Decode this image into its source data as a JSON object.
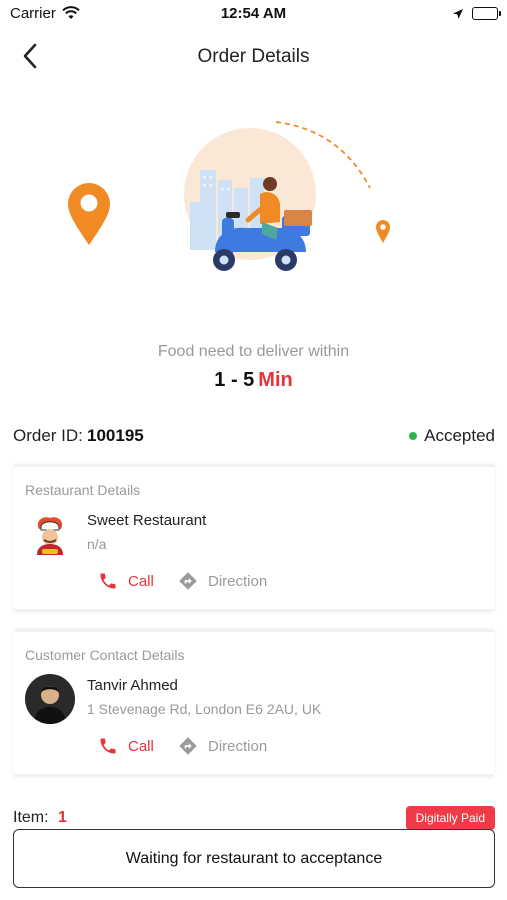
{
  "status_bar": {
    "carrier": "Carrier",
    "time": "12:54 AM"
  },
  "nav": {
    "title": "Order Details",
    "back_icon": "chevron-left-icon"
  },
  "delivery": {
    "label": "Food need to deliver within",
    "time_range": "1 - 5",
    "time_unit": "Min"
  },
  "order": {
    "id_label": "Order ID:",
    "id_value": "100195",
    "status": "Accepted",
    "status_color": "#2fb34b"
  },
  "restaurant": {
    "title": "Restaurant Details",
    "name": "Sweet Restaurant",
    "sub": "n/a",
    "call_label": "Call",
    "direction_label": "Direction"
  },
  "customer": {
    "title": "Customer Contact Details",
    "name": "Tanvir Ahmed",
    "address": "1 Stevenage Rd, London E6 2AU, UK",
    "call_label": "Call",
    "direction_label": "Direction"
  },
  "items": {
    "label": "Item:",
    "count": "1",
    "payment_badge": "Digitally Paid"
  },
  "footer": {
    "button_label": "Waiting for restaurant to acceptance"
  },
  "colors": {
    "accent": "#e8333a",
    "pin": "#f08a24",
    "badge": "#ef3a47"
  }
}
